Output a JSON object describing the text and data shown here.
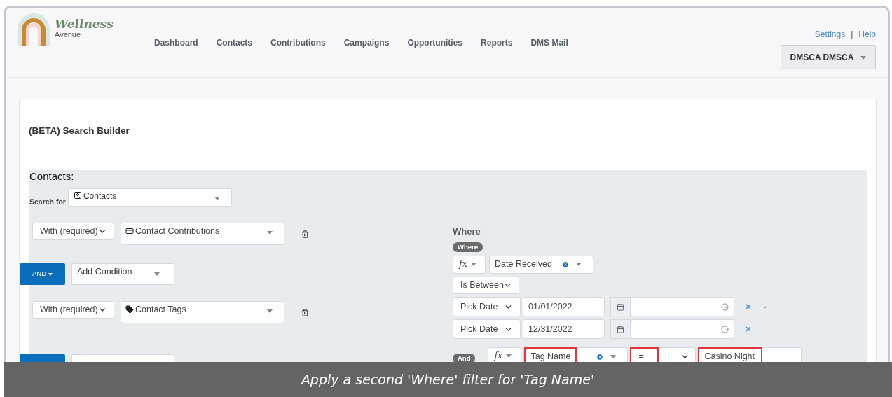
{
  "header": {
    "logo": {
      "name": "Wellness",
      "sub": "Avenue"
    },
    "nav": [
      "Dashboard",
      "Contacts",
      "Contributions",
      "Campaigns",
      "Opportunities",
      "Reports",
      "DMS Mail"
    ],
    "links": [
      "Settings",
      "|",
      "Help"
    ],
    "user_menu": "DMSCA DMSCA"
  },
  "page_title": "(BETA) Search Builder",
  "builder": {
    "heading": "Contacts:",
    "search_for": {
      "label": "Search for",
      "value": "Contacts"
    },
    "rows": [
      {
        "kind": "join",
        "mode": "With (required)",
        "entity": "Contact Contributions"
      },
      {
        "kind": "condition",
        "button": "AND",
        "placeholder": "Add Condition"
      },
      {
        "kind": "join",
        "mode": "With (required)",
        "entity": "Contact Tags"
      },
      {
        "kind": "condition"
      }
    ]
  },
  "where": {
    "heading": "Where",
    "badge": "Where",
    "fx": "fx",
    "field": "Date Received",
    "operator": "Is Between",
    "dates": [
      {
        "mode": "Pick Date",
        "date": "01/01/2022",
        "dash": "-"
      },
      {
        "mode": "Pick Date",
        "date": "12/31/2022"
      }
    ],
    "and_filter": {
      "badge": "And",
      "fx": "fx",
      "field": {
        "text": "Tag Name",
        "highlighted": true
      },
      "operator": {
        "text": "=",
        "highlighted": true
      },
      "value": {
        "text": "Casino Night",
        "highlighted": true
      }
    }
  },
  "caption": "Apply a second 'Where' filter for 'Tag Name'"
}
